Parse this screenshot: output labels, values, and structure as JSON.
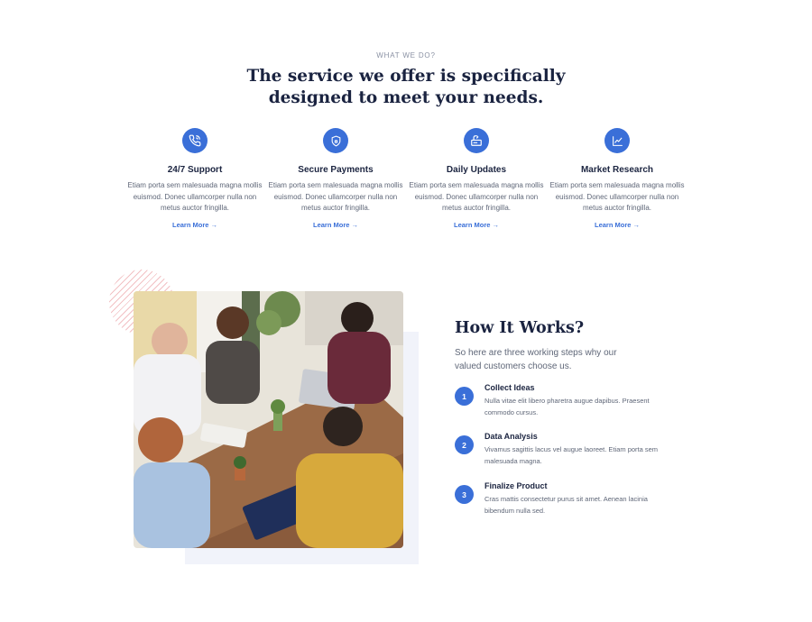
{
  "header": {
    "eyebrow": "WHAT WE DO?",
    "headline": "The service we offer is specifically designed to meet your needs."
  },
  "services": [
    {
      "icon": "phone-icon",
      "title": "24/7 Support",
      "description": "Etiam porta sem malesuada magna mollis euismod. Donec ullamcorper nulla non metus auctor fringilla.",
      "link": "Learn More →"
    },
    {
      "icon": "shield-icon",
      "title": "Secure Payments",
      "description": "Etiam porta sem malesuada magna mollis euismod. Donec ullamcorper nulla non metus auctor fringilla.",
      "link": "Learn More →"
    },
    {
      "icon": "update-icon",
      "title": "Daily Updates",
      "description": "Etiam porta sem malesuada magna mollis euismod. Donec ullamcorper nulla non metus auctor fringilla.",
      "link": "Learn More →"
    },
    {
      "icon": "chart-icon",
      "title": "Market Research",
      "description": "Etiam porta sem malesuada magna mollis euismod. Donec ullamcorper nulla non metus auctor fringilla.",
      "link": "Learn More →"
    }
  ],
  "how": {
    "title": "How It Works?",
    "subtitle": "So here are three working steps why our valued customers choose us.",
    "steps": [
      {
        "number": "1",
        "title": "Collect Ideas",
        "description": "Nulla vitae elit libero pharetra augue dapibus. Praesent commodo cursus."
      },
      {
        "number": "2",
        "title": "Data Analysis",
        "description": "Vivamus sagittis lacus vel augue laoreet. Etiam porta sem malesuada magna."
      },
      {
        "number": "3",
        "title": "Finalize Product",
        "description": "Cras mattis consectetur purus sit amet. Aenean lacinia bibendum nulla sed."
      }
    ]
  },
  "colors": {
    "accent": "#3a6fd8",
    "heading": "#1a2340",
    "body": "#5f6778"
  }
}
